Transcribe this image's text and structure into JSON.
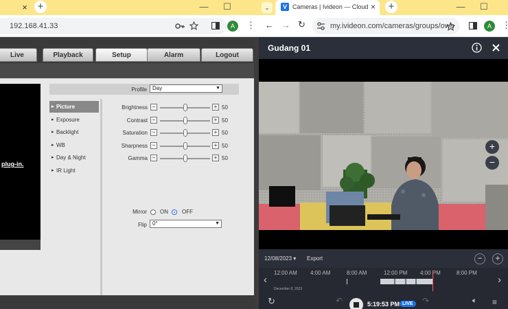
{
  "left_browser": {
    "tab_close": "×",
    "new_tab": "+",
    "url": "192.168.41.33",
    "profile_initial": "A"
  },
  "dvr": {
    "tabs": [
      "Live",
      "Playback",
      "Setup",
      "Alarm",
      "Logout"
    ],
    "selected_tab": "Setup",
    "plugin_text": "plug-in.",
    "profile": {
      "label": "Profile",
      "value": "Day"
    },
    "menu": [
      "Picture",
      "Exposure",
      "Backlight",
      "WB",
      "Day & Night",
      "IR Light"
    ],
    "selected_menu": "Picture",
    "sliders": [
      {
        "label": "Brightness",
        "value": "50",
        "level": 0.5
      },
      {
        "label": "Contrast",
        "value": "50",
        "level": 0.5
      },
      {
        "label": "Saturation",
        "value": "50",
        "level": 0.5
      },
      {
        "label": "Sharpness",
        "value": "50",
        "level": 0.5
      },
      {
        "label": "Gamma",
        "value": "50",
        "level": 0.5
      }
    ],
    "mirror": {
      "label": "Mirror",
      "on": "ON",
      "off": "OFF",
      "selected": "OFF"
    },
    "flip": {
      "label": "Flip",
      "value": "0°"
    }
  },
  "right_browser": {
    "tab_title": "Cameras | Ivideon — Cloud Vid",
    "favicon_letter": "V",
    "url": "my.ivideon.com/cameras/groups/own",
    "profile_initial": "A"
  },
  "ivideon": {
    "camera_title": "Gudang 01",
    "date": "12/08/2023",
    "export": "Export",
    "timeline_ticks": [
      "12:00 AM",
      "4:00 AM",
      "8:00 AM",
      "12:00 PM",
      "4:00 PM",
      "8:00 PM"
    ],
    "day_label": "December 8, 2023",
    "time": "5:19:53 PM",
    "live": "LIVE",
    "zoom_in": "+",
    "zoom_out": "−"
  },
  "colors": {
    "browser_tab_bar": "#fde68a",
    "accent_blue": "#1a73e8",
    "playhead": "#ff5a5a"
  }
}
